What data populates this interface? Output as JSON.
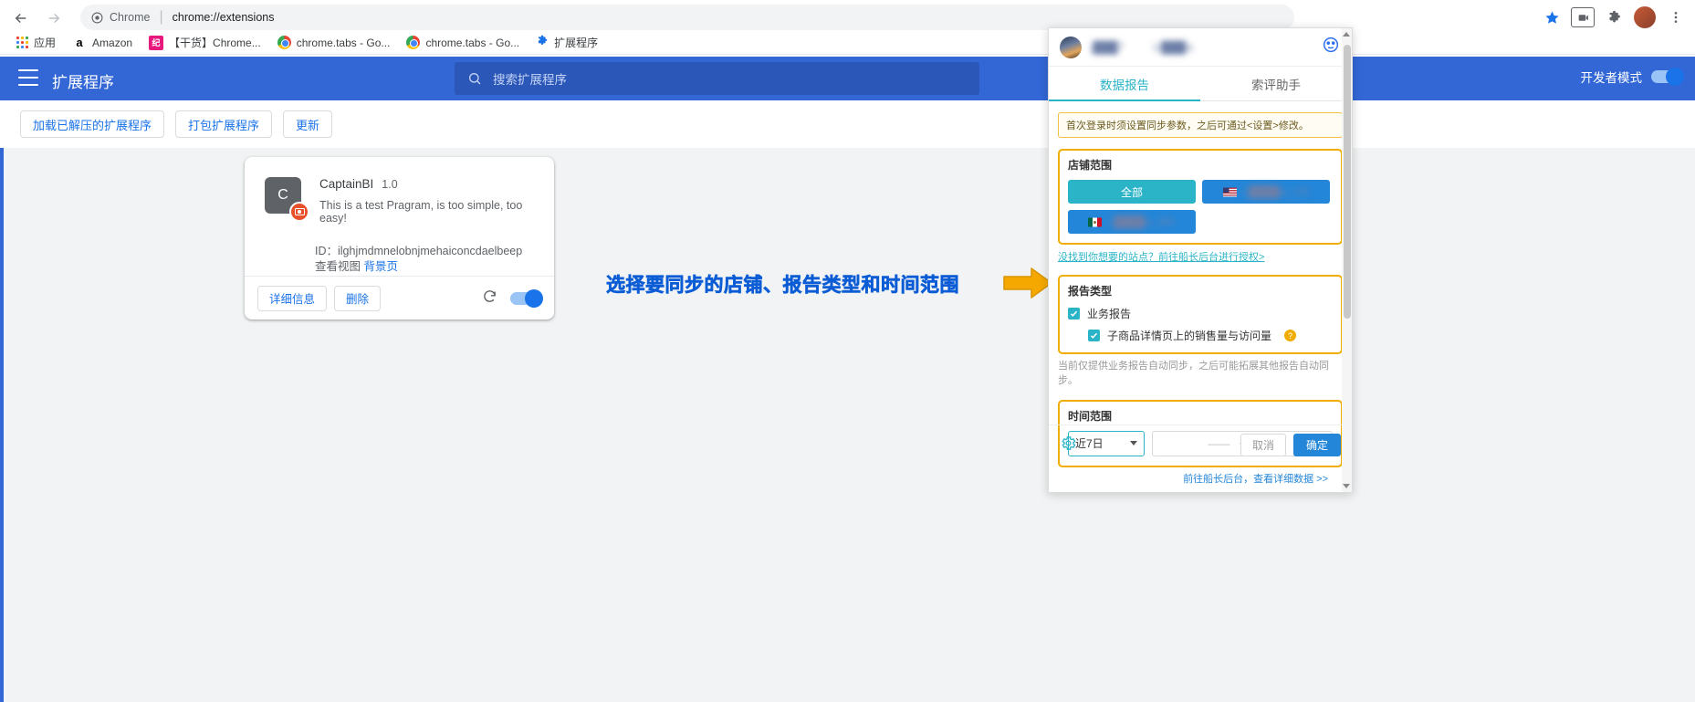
{
  "browser": {
    "back_icon": "back-arrow-icon",
    "forward_icon": "forward-arrow-icon",
    "reload_icon": "reload-icon",
    "omnibox": {
      "site_chip": "Chrome",
      "separator": "|",
      "url": "chrome://extensions"
    },
    "star_icon": "bookmark-star-icon",
    "menu_icon": "three-dot-menu-icon",
    "bookmarks": [
      {
        "label": "应用",
        "icon": "apps-grid-icon"
      },
      {
        "label": "Amazon",
        "icon": "amazon-favicon"
      },
      {
        "label": "【干货】Chrome...",
        "icon": "pink-favicon"
      },
      {
        "label": "chrome.tabs - Go...",
        "icon": "chrome-favicon"
      },
      {
        "label": "chrome.tabs - Go...",
        "icon": "chrome-favicon"
      },
      {
        "label": "扩展程序",
        "icon": "puzzle-piece-icon"
      }
    ]
  },
  "extensions_page": {
    "title": "扩展程序",
    "menu_icon": "hamburger-menu-icon",
    "search_placeholder": "搜索扩展程序",
    "search_icon": "search-icon",
    "dev_mode_label": "开发者模式",
    "toolbar": {
      "load_unpacked": "加载已解压的扩展程序",
      "pack": "打包扩展程序",
      "update": "更新"
    },
    "card": {
      "icon_letter": "C",
      "name": "CaptainBI",
      "version": "1.0",
      "description": "This is a test Pragram, is too simple, too easy!",
      "id_label": "ID：ilghjmdmnelobnjmehaiconcdaelbeep",
      "views_label": "查看视图",
      "views_link": "背景页",
      "details_btn": "详细信息",
      "remove_btn": "删除",
      "reload_icon": "reload-extension-icon",
      "enable_toggle": "on"
    }
  },
  "annotation": {
    "text": "选择要同步的店铺、报告类型和时间范围",
    "arrow_icon": "right-arrow-annotation",
    "color": "#0b5cd5",
    "arrow_color": "#f5a800"
  },
  "popup": {
    "user_name": "j███7",
    "shop_name": "U███ic",
    "avatar_icon": "user-avatar",
    "header_icon": "assistant-face-icon",
    "tabs": [
      {
        "label": "数据报告",
        "active": true
      },
      {
        "label": "索评助手",
        "active": false
      }
    ],
    "notice": "首次登录时须设置同步参数，之后可通过<设置>修改。",
    "store_scope": {
      "title": "店铺范围",
      "chips": [
        {
          "label": "全部",
          "type": "all"
        },
        {
          "label": "L████w_US",
          "type": "site",
          "flag": "us"
        },
        {
          "label": "L████w_MX",
          "type": "site",
          "flag": "mx"
        }
      ],
      "help_link": "没找到你想要的站点？前往船长后台进行授权>"
    },
    "report_type": {
      "title": "报告类型",
      "items": [
        {
          "label": "业务报告",
          "checked": true,
          "sub": false
        },
        {
          "label": "子商品详情页上的销售量与访问量",
          "checked": true,
          "sub": true,
          "help_icon": "question-mark-icon"
        }
      ],
      "hint": "当前仅提供业务报告自动同步，之后可能拓展其他报告自动同步。"
    },
    "time_range": {
      "title": "时间范围",
      "select_value": "近7日",
      "select_icon": "chevron-down-icon",
      "date_start": "——",
      "date_sep": "~",
      "date_end": "——"
    },
    "footer": {
      "settings_icon": "gear-icon",
      "cancel_btn": "取消",
      "confirm_btn": "确定",
      "bottom_link": "前往船长后台，查看详细数据 >>"
    },
    "accent_teal": "#2bb4c8",
    "accent_blue": "#2486d8",
    "highlight_orange": "#f0ad00"
  }
}
